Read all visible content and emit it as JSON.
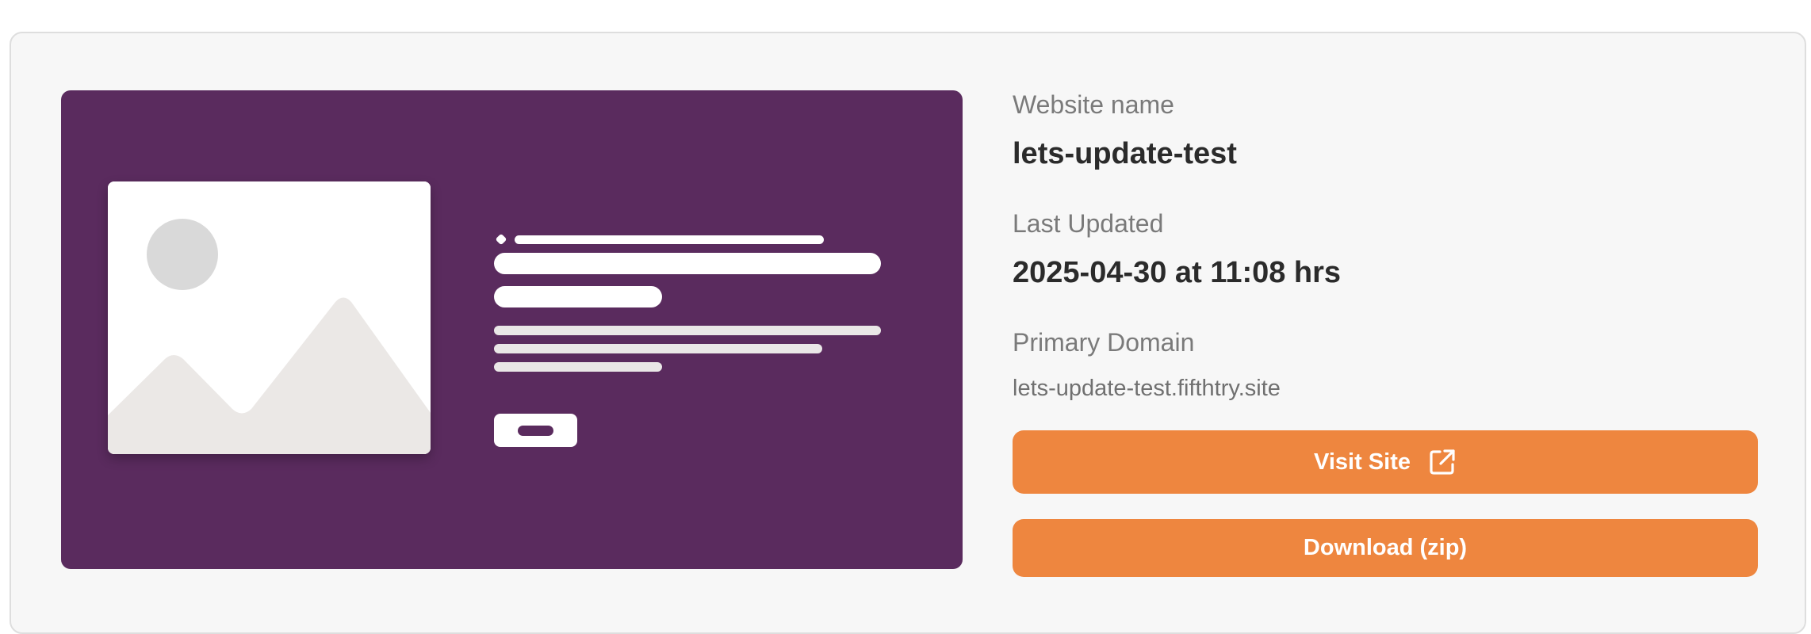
{
  "site": {
    "name_label": "Website name",
    "name_value": "lets-update-test",
    "updated_label": "Last Updated",
    "updated_value": "2025-04-30 at 11:08 hrs",
    "domain_label": "Primary Domain",
    "domain_value": "lets-update-test.fifthtry.site"
  },
  "actions": {
    "visit_label": "Visit Site",
    "visit_icon": "external-link-icon",
    "download_label": "Download (zip)"
  },
  "colors": {
    "preview_background": "#5a2b5e",
    "button_accent": "#ee863f"
  },
  "preview": {
    "image_icon": "image-placeholder-icon"
  }
}
